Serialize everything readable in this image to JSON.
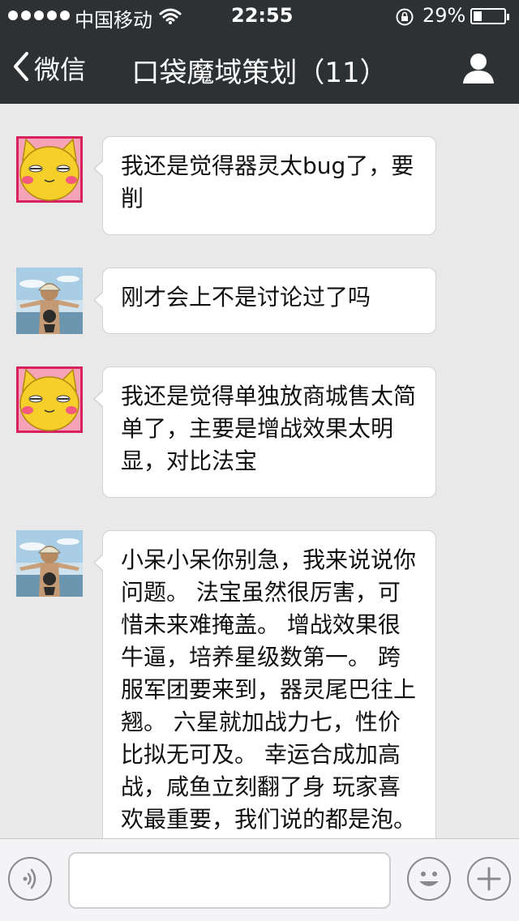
{
  "status_bar": {
    "carrier": "中国移动",
    "time": "22:55",
    "battery_percent": "29%",
    "battery_level": 0.29,
    "icons": [
      "signal-dots",
      "wifi-icon",
      "rotation-lock-icon",
      "battery-icon"
    ]
  },
  "nav": {
    "back_label": "微信",
    "title": "口袋魔域策划（11）",
    "right_icon": "person-icon"
  },
  "messages": [
    {
      "sender": "cat-avatar",
      "text": "我还是觉得器灵太bug了，要削"
    },
    {
      "sender": "photo-avatar",
      "text": "刚才会上不是讨论过了吗"
    },
    {
      "sender": "cat-avatar",
      "text": "我还是觉得单独放商城售太简单了，主要是增战效果太明显，对比法宝"
    },
    {
      "sender": "photo-avatar",
      "text": "小呆小呆你别急，我来说说你问题。 法宝虽然很厉害，可惜未来难掩盖。 增战效果很牛逼，培养星级数第一。 跨服军团要来到，器灵尾巴往上翘。 六星就加战力七，性价比拟无可及。 幸运合成加高战，咸鱼立刻翻了身 玩家喜欢最重要，我们说的都是泡。"
    }
  ],
  "input_bar": {
    "left_icon": "voice-icon",
    "input_value": "",
    "emoji_icon": "emoji-icon",
    "plus_icon": "plus-icon"
  },
  "colors": {
    "header_bg": "#2e3134",
    "chat_bg": "#e9e9e9",
    "bubble_bg": "#ffffff",
    "cat_yellow": "#f7cf2a"
  }
}
